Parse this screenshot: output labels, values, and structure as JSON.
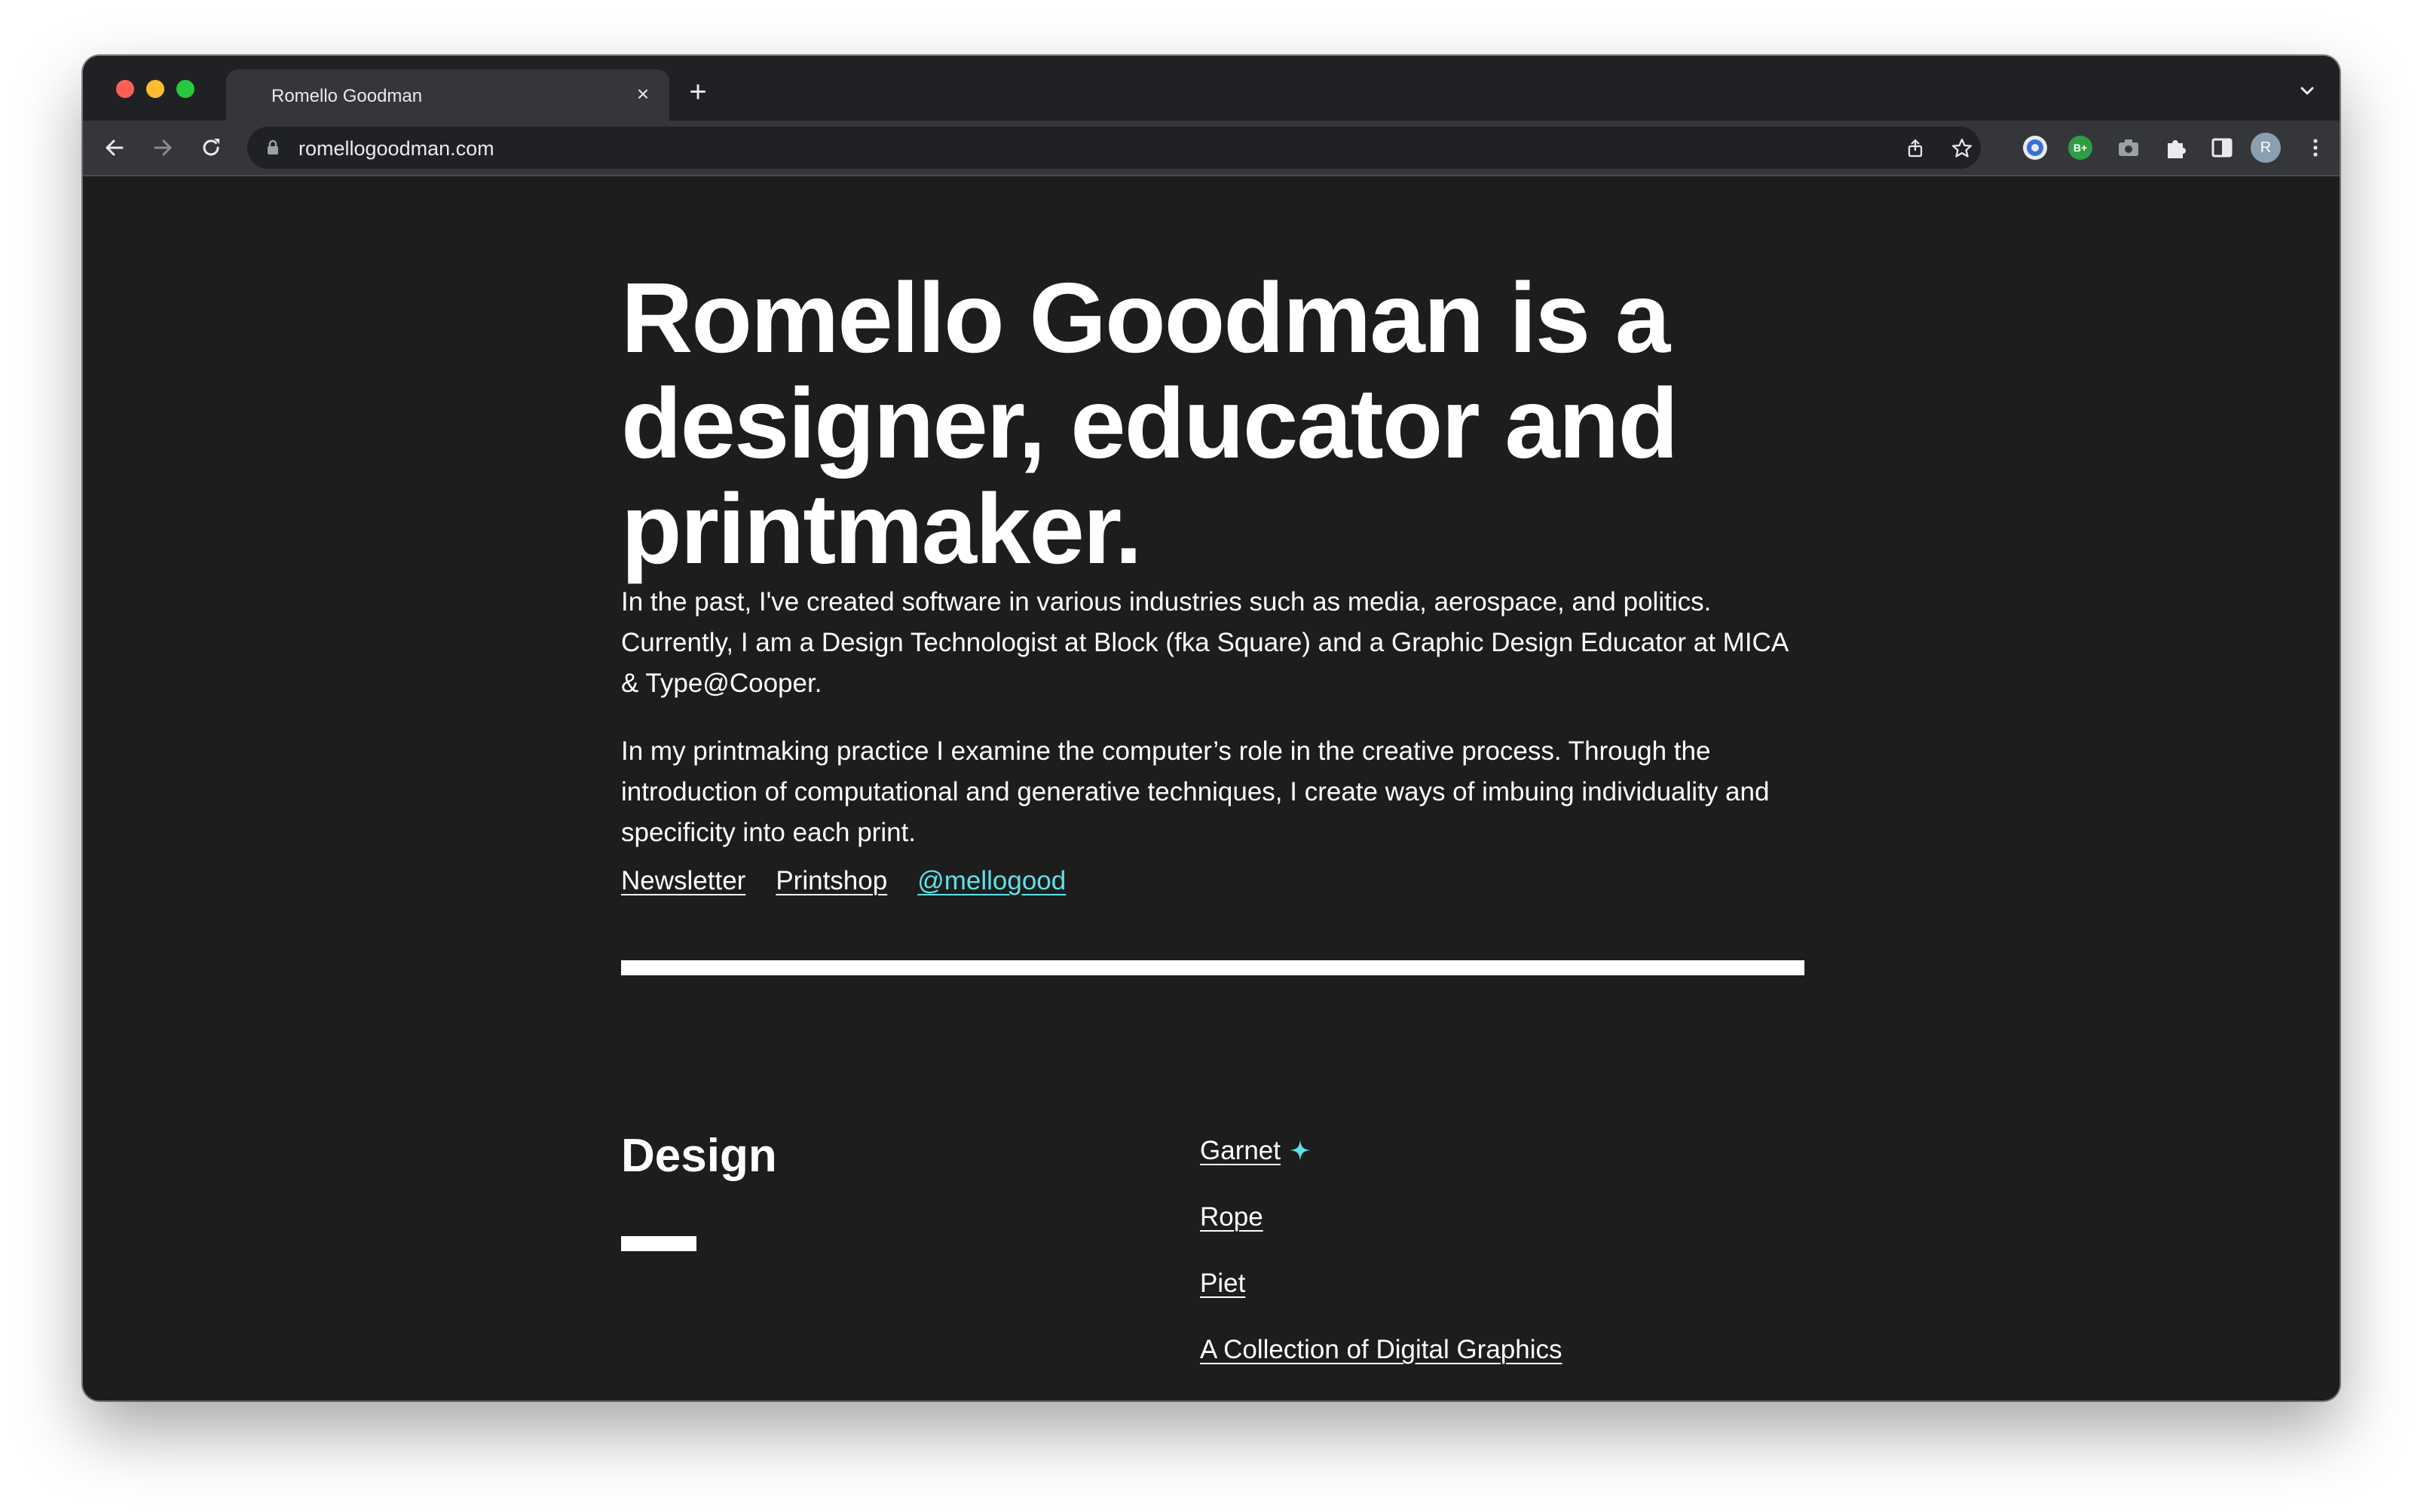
{
  "browser": {
    "tab_title": "Romello Goodman",
    "new_tab_symbol": "+",
    "close_symbol": "×",
    "url": "romellogoodman.com",
    "avatar_initial": "R",
    "extension_badge": "B+"
  },
  "page": {
    "headline": "Romello Goodman is a designer, educator and printmaker.",
    "paragraph_1": "In the past, I've created software in various industries such as media, aerospace, and politics. Currently, I am a Design Technologist at Block (fka Square) and a Graphic Design Educator at MICA & Type@Cooper.",
    "paragraph_2": "In my printmaking practice I examine the computer’s role in the creative process. Through the introduction of computational and generative techniques, I create ways of imbuing individuality and specificity into each print.",
    "links": {
      "newsletter": "Newsletter",
      "printshop": "Printshop",
      "twitter": "@mellogood"
    },
    "section_title": "Design",
    "projects": [
      {
        "label": "Garnet",
        "featured": true
      },
      {
        "label": "Rope",
        "featured": false
      },
      {
        "label": "Piet",
        "featured": false
      },
      {
        "label": "A Collection of Digital Graphics",
        "featured": false
      }
    ]
  },
  "colors": {
    "page_background": "#1d1d1d",
    "text": "#ffffff",
    "accent": "#5ee1e6",
    "chrome_tabstrip": "#202124",
    "chrome_toolbar": "#35363a"
  },
  "icons": {
    "close": "close-icon",
    "new_tab": "plus-icon",
    "tab_search": "chevron-down-icon",
    "back": "back-arrow-icon",
    "forward": "forward-arrow-icon",
    "reload": "reload-icon",
    "lock": "lock-icon",
    "share": "share-icon",
    "bookmark": "star-icon",
    "extensions": "puzzle-icon",
    "side_panel": "side-panel-icon",
    "menu": "kebab-menu-icon",
    "featured": "sparkle-icon"
  }
}
